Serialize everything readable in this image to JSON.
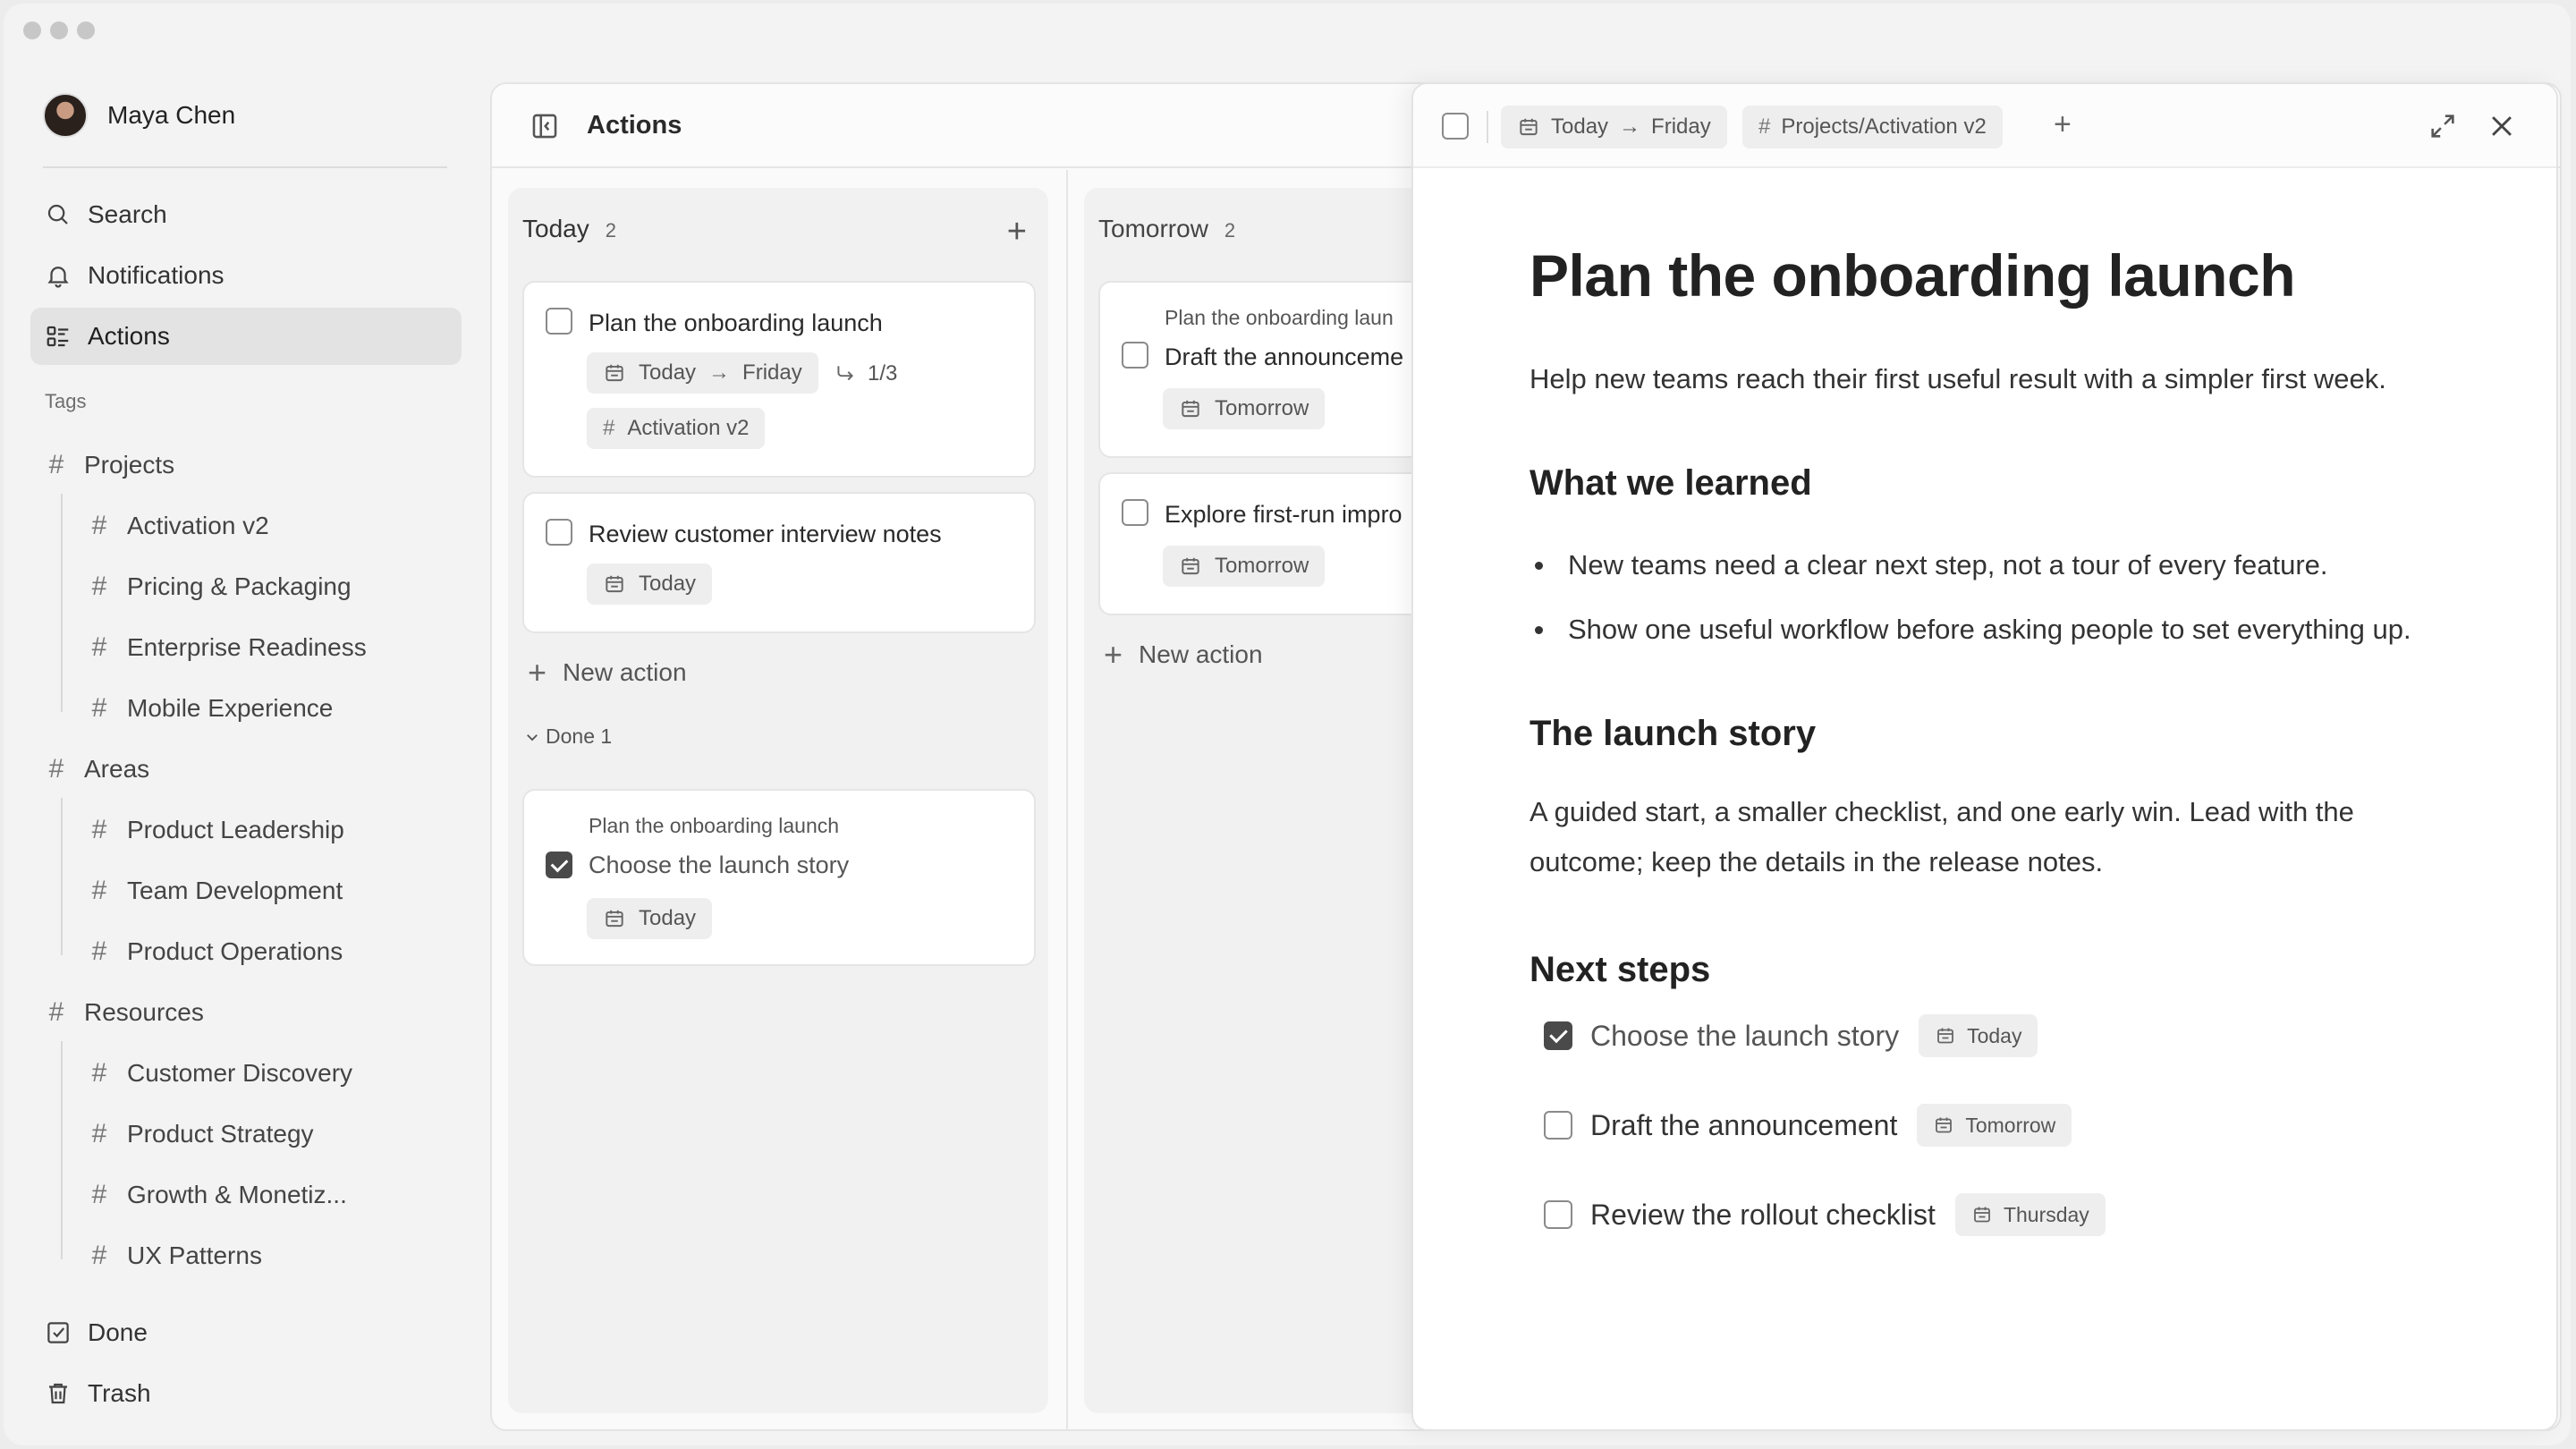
{
  "user": {
    "name": "Maya Chen"
  },
  "nav": {
    "search": "Search",
    "notifications": "Notifications",
    "actions": "Actions",
    "done": "Done",
    "trash": "Trash"
  },
  "tags": {
    "label": "Tags",
    "groups": [
      {
        "name": "Projects",
        "children": [
          "Activation v2",
          "Pricing & Packaging",
          "Enterprise Readiness",
          "Mobile Experience"
        ]
      },
      {
        "name": "Areas",
        "children": [
          "Product Leadership",
          "Team Development",
          "Product Operations"
        ]
      },
      {
        "name": "Resources",
        "children": [
          "Customer Discovery",
          "Product Strategy",
          "Growth & Monetiz...",
          "UX Patterns"
        ]
      }
    ]
  },
  "board": {
    "title": "Actions",
    "columns": [
      {
        "name": "Today",
        "count": "2",
        "cards": [
          {
            "title": "Plan the onboarding launch",
            "date_from": "Today",
            "date_to": "Friday",
            "subtasks": "1/3",
            "tag": "Activation v2"
          },
          {
            "title": "Review customer interview notes",
            "date": "Today"
          }
        ],
        "new_action": "New action",
        "done_label": "Done 1",
        "done_cards": [
          {
            "parent": "Plan the onboarding launch",
            "title": "Choose the launch story",
            "date": "Today",
            "checked": true
          }
        ]
      },
      {
        "name": "Tomorrow",
        "count": "2",
        "cards": [
          {
            "parent": "Plan the onboarding laun",
            "title": "Draft the announceme",
            "date": "Tomorrow"
          },
          {
            "title": "Explore first-run impro",
            "date": "Tomorrow"
          }
        ],
        "new_action": "New action"
      }
    ]
  },
  "detail": {
    "header": {
      "date_from": "Today",
      "date_to": "Friday",
      "tag": "Projects/Activation v2",
      "add": "+"
    },
    "title": "Plan the onboarding launch",
    "intro": "Help new teams reach their first useful result with a simpler first week.",
    "section1": {
      "heading": "What we learned",
      "bullets": [
        "New teams need a clear next step, not a tour of every feature.",
        "Show one useful workflow before asking people to set everything up."
      ]
    },
    "section2": {
      "heading": "The launch story",
      "body": "A guided start, a smaller checklist, and one early win. Lead with the outcome; keep the details in the release notes."
    },
    "section3": {
      "heading": "Next steps",
      "todos": [
        {
          "text": "Choose the launch story",
          "date": "Today",
          "checked": true
        },
        {
          "text": "Draft the announcement",
          "date": "Tomorrow",
          "checked": false
        },
        {
          "text": "Review the rollout checklist",
          "date": "Thursday",
          "checked": false
        }
      ]
    }
  }
}
